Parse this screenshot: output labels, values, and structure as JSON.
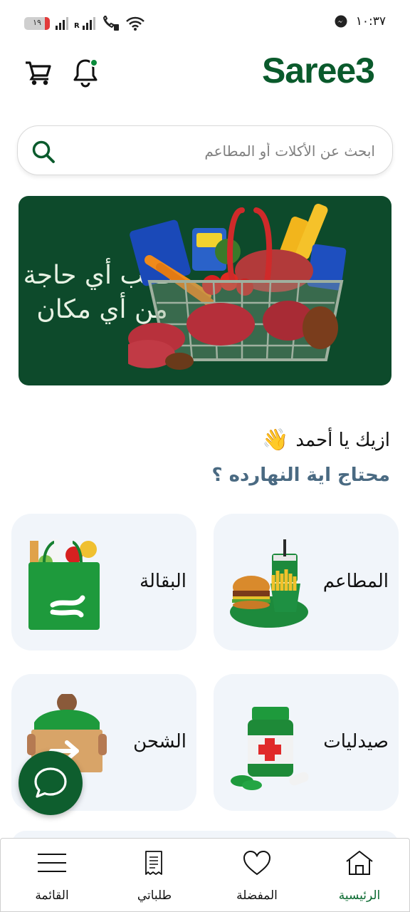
{
  "status_bar": {
    "battery_level": "١٩",
    "battery_percent": 19,
    "network_label": "R",
    "time": "١٠:٣٧"
  },
  "header": {
    "logo_text": "Saree3",
    "cart_icon": "shopping-cart-icon",
    "bell_icon": "notification-bell-icon",
    "has_notification_dot": true
  },
  "search": {
    "placeholder": "ابحث عن الأكلات أو المطاعم",
    "icon": "search-icon"
  },
  "banner": {
    "line1": "اطلب أي حاجة",
    "line2": "من أي مكان"
  },
  "greeting": {
    "text": "ازيك يا أحمد",
    "emoji": "👋",
    "subtitle": "محتاج اية النهارده ؟"
  },
  "categories": [
    {
      "label": "المطاعم",
      "icon": "burger-fries-icon"
    },
    {
      "label": "البقالة",
      "icon": "grocery-bag-icon"
    },
    {
      "label": "صيدليات",
      "icon": "medicine-bottle-icon"
    },
    {
      "label": "الشحن",
      "icon": "delivery-box-icon"
    }
  ],
  "bottom_nav": [
    {
      "label": "الرئيسية",
      "icon": "home-icon",
      "active": true
    },
    {
      "label": "المفضلة",
      "icon": "heart-icon",
      "active": false
    },
    {
      "label": "طلباتي",
      "icon": "receipt-icon",
      "active": false
    },
    {
      "label": "القائمة",
      "icon": "menu-icon",
      "active": false
    }
  ],
  "colors": {
    "brand_green": "#0a5a2c",
    "banner_bg": "#0d4a2b",
    "card_bg": "#f1f5fa",
    "subtitle": "#4a6a82",
    "active_nav": "#0a6a30"
  }
}
